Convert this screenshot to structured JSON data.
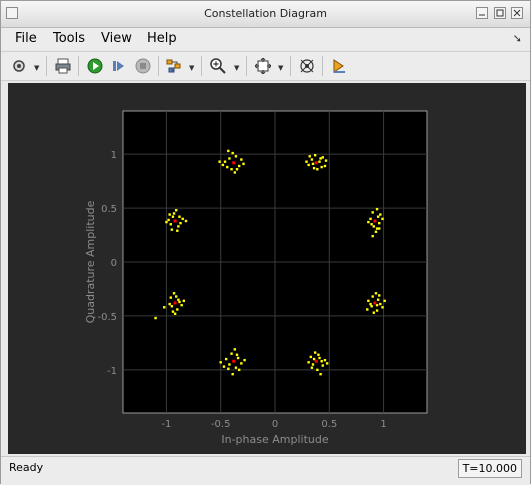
{
  "window": {
    "title": "Constellation Diagram"
  },
  "menu": {
    "items": [
      "File",
      "Tools",
      "View",
      "Help"
    ]
  },
  "toolbar": {
    "icons": [
      "settings-icon",
      "print-icon",
      "run-icon",
      "step-forward-icon",
      "stop-icon",
      "highlight-icon",
      "zoom-in-icon",
      "zoom-fit-icon",
      "layout-icon",
      "marker-icon"
    ]
  },
  "chart_data": {
    "type": "scatter",
    "title": "",
    "xlabel": "In-phase Amplitude",
    "ylabel": "Quadrature Amplitude",
    "xlim": [
      -1.4,
      1.4
    ],
    "ylim": [
      -1.4,
      1.4
    ],
    "xticks": [
      "-1",
      "-0.5",
      "0",
      "0.5",
      "1"
    ],
    "yticks": [
      "1",
      "0.5",
      "0",
      "-0.5",
      "-1"
    ],
    "grid": true,
    "clusters": [
      {
        "x": 0.38,
        "y": 0.92
      },
      {
        "x": -0.38,
        "y": 0.92
      },
      {
        "x": -0.92,
        "y": 0.38
      },
      {
        "x": 0.92,
        "y": 0.38
      },
      {
        "x": -0.92,
        "y": -0.38
      },
      {
        "x": 0.92,
        "y": -0.38
      },
      {
        "x": -0.38,
        "y": -0.92
      },
      {
        "x": 0.38,
        "y": -0.92
      }
    ],
    "series": [
      {
        "name": "",
        "color": "#ffff00",
        "points": [
          [
            0.38,
            0.92
          ],
          [
            0.34,
            0.95
          ],
          [
            0.42,
            0.96
          ],
          [
            0.31,
            0.9
          ],
          [
            0.46,
            0.89
          ],
          [
            0.36,
            0.87
          ],
          [
            0.41,
            0.93
          ],
          [
            0.44,
            0.97
          ],
          [
            0.32,
            0.98
          ],
          [
            0.39,
            0.86
          ],
          [
            0.47,
            0.94
          ],
          [
            0.29,
            0.93
          ],
          [
            0.37,
            0.99
          ],
          [
            0.35,
            0.91
          ],
          [
            0.43,
            0.88
          ],
          [
            -0.38,
            0.92
          ],
          [
            -0.42,
            0.96
          ],
          [
            -0.33,
            0.89
          ],
          [
            -0.46,
            0.93
          ],
          [
            -0.36,
            0.98
          ],
          [
            -0.4,
            0.86
          ],
          [
            -0.31,
            0.95
          ],
          [
            -0.48,
            0.9
          ],
          [
            -0.35,
            0.86
          ],
          [
            -0.44,
            0.88
          ],
          [
            -0.39,
            1.01
          ],
          [
            -0.29,
            0.91
          ],
          [
            -0.51,
            0.93
          ],
          [
            -0.37,
            0.83
          ],
          [
            -0.43,
            1.03
          ],
          [
            -0.92,
            0.38
          ],
          [
            -0.96,
            0.35
          ],
          [
            -0.88,
            0.42
          ],
          [
            -0.93,
            0.45
          ],
          [
            -0.98,
            0.39
          ],
          [
            -0.89,
            0.33
          ],
          [
            -0.85,
            0.4
          ],
          [
            -0.95,
            0.3
          ],
          [
            -0.91,
            0.48
          ],
          [
            -0.87,
            0.36
          ],
          [
            -1.0,
            0.37
          ],
          [
            -0.82,
            0.38
          ],
          [
            -0.94,
            0.42
          ],
          [
            -0.9,
            0.29
          ],
          [
            -0.97,
            0.44
          ],
          [
            0.92,
            0.38
          ],
          [
            0.95,
            0.42
          ],
          [
            0.89,
            0.35
          ],
          [
            0.94,
            0.31
          ],
          [
            0.9,
            0.46
          ],
          [
            0.96,
            0.36
          ],
          [
            0.88,
            0.4
          ],
          [
            0.93,
            0.28
          ],
          [
            0.97,
            0.44
          ],
          [
            0.91,
            0.33
          ],
          [
            0.99,
            0.4
          ],
          [
            0.86,
            0.37
          ],
          [
            0.94,
            0.49
          ],
          [
            0.9,
            0.24
          ],
          [
            0.96,
            0.31
          ],
          [
            -0.92,
            -0.38
          ],
          [
            -0.95,
            -0.41
          ],
          [
            -0.89,
            -0.35
          ],
          [
            -0.94,
            -0.46
          ],
          [
            -0.91,
            -0.32
          ],
          [
            -0.97,
            -0.39
          ],
          [
            -0.86,
            -0.4
          ],
          [
            -0.93,
            -0.29
          ],
          [
            -0.9,
            -0.44
          ],
          [
            -0.88,
            -0.37
          ],
          [
            -1.02,
            -0.42
          ],
          [
            -0.84,
            -0.36
          ],
          [
            -0.96,
            -0.33
          ],
          [
            -0.92,
            -0.48
          ],
          [
            -1.1,
            -0.52
          ],
          [
            0.92,
            -0.38
          ],
          [
            0.95,
            -0.35
          ],
          [
            0.89,
            -0.41
          ],
          [
            0.94,
            -0.45
          ],
          [
            0.9,
            -0.32
          ],
          [
            0.97,
            -0.39
          ],
          [
            0.86,
            -0.36
          ],
          [
            0.93,
            -0.29
          ],
          [
            0.99,
            -0.42
          ],
          [
            0.91,
            -0.47
          ],
          [
            0.85,
            -0.44
          ],
          [
            0.96,
            -0.31
          ],
          [
            0.88,
            -0.39
          ],
          [
            1.01,
            -0.36
          ],
          [
            0.94,
            -0.4
          ],
          [
            -0.38,
            -0.92
          ],
          [
            -0.42,
            -0.95
          ],
          [
            -0.34,
            -0.89
          ],
          [
            -0.45,
            -0.9
          ],
          [
            -0.36,
            -0.98
          ],
          [
            -0.4,
            -0.85
          ],
          [
            -0.31,
            -0.94
          ],
          [
            -0.47,
            -0.97
          ],
          [
            -0.35,
            -0.86
          ],
          [
            -0.43,
            -0.99
          ],
          [
            -0.39,
            -1.04
          ],
          [
            -0.28,
            -0.91
          ],
          [
            -0.5,
            -0.93
          ],
          [
            -0.37,
            -0.81
          ],
          [
            -0.33,
            -1.0
          ],
          [
            0.38,
            -0.92
          ],
          [
            0.35,
            -0.95
          ],
          [
            0.41,
            -0.89
          ],
          [
            0.44,
            -0.96
          ],
          [
            0.33,
            -0.88
          ],
          [
            0.39,
            -1.0
          ],
          [
            0.46,
            -0.91
          ],
          [
            0.31,
            -0.93
          ],
          [
            0.37,
            -0.84
          ],
          [
            0.42,
            -1.04
          ],
          [
            0.36,
            -0.9
          ],
          [
            0.48,
            -0.94
          ],
          [
            0.34,
            -0.98
          ],
          [
            0.4,
            -0.86
          ],
          [
            0.43,
            -0.92
          ]
        ]
      },
      {
        "name": "",
        "color": "#ff0000",
        "points": [
          [
            0.38,
            0.92
          ],
          [
            -0.38,
            0.92
          ],
          [
            -0.92,
            0.38
          ],
          [
            0.92,
            0.38
          ],
          [
            -0.92,
            -0.38
          ],
          [
            0.92,
            -0.38
          ],
          [
            -0.38,
            -0.92
          ],
          [
            0.38,
            -0.92
          ]
        ]
      }
    ]
  },
  "status": {
    "left": "Ready",
    "time": "T=10.000"
  }
}
